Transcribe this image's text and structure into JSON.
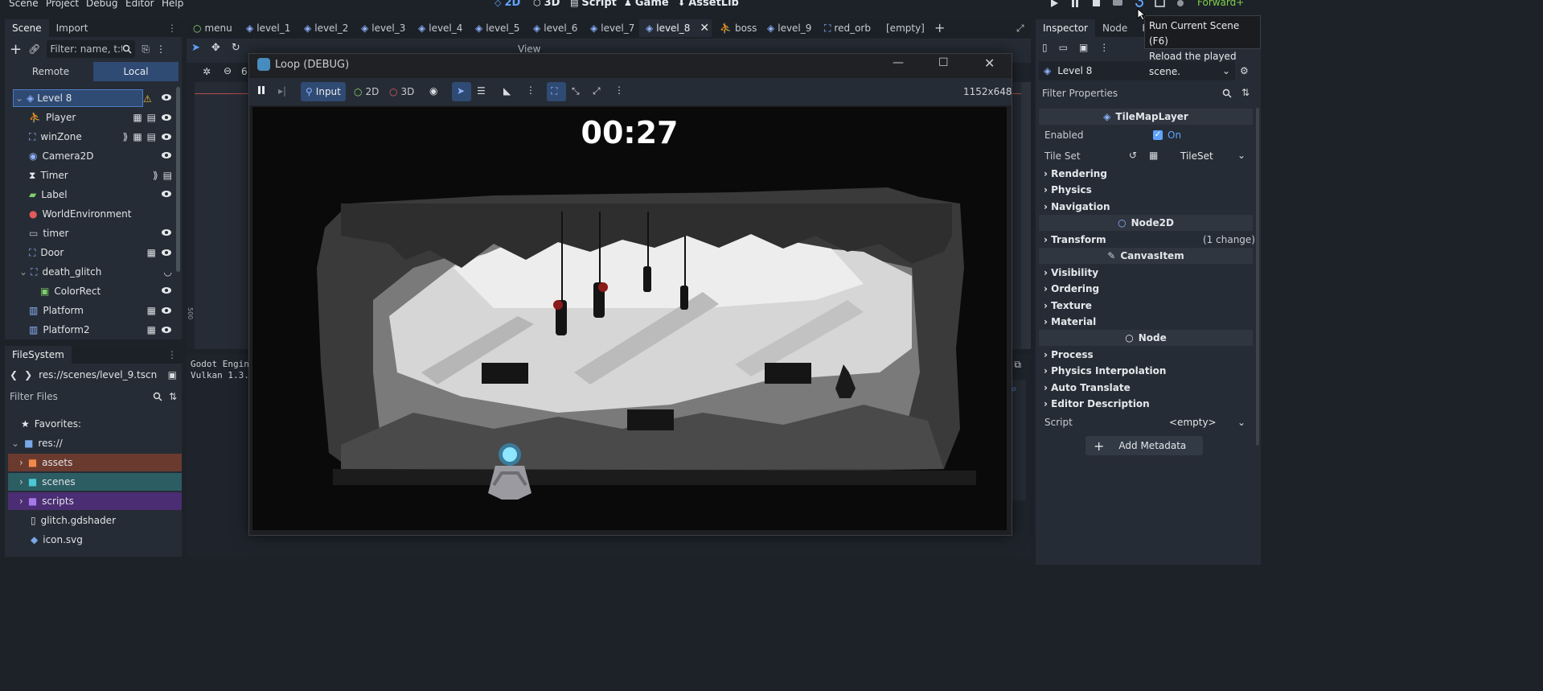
{
  "menubar": {
    "items": [
      "Scene",
      "Project",
      "Debug",
      "Editor",
      "Help"
    ],
    "modes": [
      {
        "label": "2D",
        "icon": "2d-icon",
        "active": true
      },
      {
        "label": "3D",
        "icon": "3d-icon",
        "active": false
      },
      {
        "label": "Script",
        "icon": "script-icon",
        "active": false
      },
      {
        "label": "Game",
        "icon": "game-icon",
        "active": false
      },
      {
        "label": "AssetLib",
        "icon": "assetlib-icon",
        "active": false
      }
    ],
    "renderer": "Forward+"
  },
  "tooltip": {
    "line1": "Run Current Scene (F6)",
    "line2": "Reload the played scene."
  },
  "scene_dock": {
    "tabs": [
      "Scene",
      "Import"
    ],
    "filter_placeholder": "Filter: name, t:t",
    "remote_label": "Remote",
    "local_label": "Local",
    "nodes": [
      {
        "name": "Level 8",
        "icon": "node2d-icon",
        "depth": 0
      },
      {
        "name": "Player",
        "icon": "character-icon",
        "depth": 1
      },
      {
        "name": "winZone",
        "icon": "area-icon",
        "depth": 1
      },
      {
        "name": "Camera2D",
        "icon": "camera-icon",
        "depth": 1
      },
      {
        "name": "Timer",
        "icon": "timer-icon",
        "depth": 1
      },
      {
        "name": "Label",
        "icon": "label-icon",
        "depth": 1
      },
      {
        "name": "WorldEnvironment",
        "icon": "world-icon",
        "depth": 1
      },
      {
        "name": "timer",
        "icon": "canvas-layer-icon",
        "depth": 1
      },
      {
        "name": "Door",
        "icon": "area-icon",
        "depth": 1
      },
      {
        "name": "death_glitch",
        "icon": "canvas-layer-icon",
        "depth": 1
      },
      {
        "name": "ColorRect",
        "icon": "colorrect-icon",
        "depth": 2
      },
      {
        "name": "Platform",
        "icon": "tilemap-icon",
        "depth": 1
      },
      {
        "name": "Platform2",
        "icon": "tilemap-icon",
        "depth": 1
      }
    ]
  },
  "filesystem": {
    "title": "FileSystem",
    "path": "res://scenes/level_9.tscn",
    "filter_placeholder": "Filter Files",
    "items": [
      {
        "name": "Favorites:",
        "icon": "star-icon"
      },
      {
        "name": "res://",
        "icon": "folder-icon"
      },
      {
        "name": "assets",
        "icon": "folder-icon",
        "color": "#6b3a2e"
      },
      {
        "name": "scenes",
        "icon": "folder-icon",
        "color": "#2b5d63"
      },
      {
        "name": "scripts",
        "icon": "folder-icon",
        "color": "#4b2d73"
      },
      {
        "name": "glitch.gdshader",
        "icon": "file-icon"
      },
      {
        "name": "icon.svg",
        "icon": "image-icon"
      }
    ]
  },
  "editor_tabs": [
    "menu",
    "level_1",
    "level_2",
    "level_3",
    "level_4",
    "level_5",
    "level_6",
    "level_7",
    "level_8",
    "boss",
    "level_9",
    "red_orb",
    "[empty]"
  ],
  "viewport": {
    "view_label": "View",
    "ruler_left": "500",
    "ruler_top": "6"
  },
  "output": {
    "line1": "Godot Engin",
    "line2": "Vulkan 1.3.:"
  },
  "debug_window": {
    "title": "Loop (DEBUG)",
    "toolbar": {
      "input": "Input",
      "two_d": "2D",
      "three_d": "3D"
    },
    "resolution": "1152x648",
    "timer_text": "00:27"
  },
  "inspector": {
    "tabs": [
      "Inspector",
      "Node",
      "Hi"
    ],
    "object": "Level 8",
    "filter_placeholder": "Filter Properties",
    "sections": [
      {
        "title": "TileMapLayer",
        "icon": "tilemap-icon"
      },
      {
        "title": "Node2D",
        "icon": "node2d-icon"
      },
      {
        "title": "CanvasItem",
        "icon": "canvasitem-icon"
      },
      {
        "title": "Node",
        "icon": "node-icon"
      }
    ],
    "enabled_label": "Enabled",
    "enabled_value": "On",
    "tileset_label": "Tile Set",
    "tileset_value": "TileSet",
    "groups_tilemap": [
      "Rendering",
      "Physics",
      "Navigation"
    ],
    "transform_label": "Transform",
    "transform_note": "(1 change)",
    "groups_canvas": [
      "Visibility",
      "Ordering",
      "Texture",
      "Material"
    ],
    "groups_node": [
      "Process",
      "Physics Interpolation",
      "Auto Translate",
      "Editor Description"
    ],
    "script_label": "Script",
    "script_value": "<empty>",
    "add_metadata": "Add Metadata"
  }
}
